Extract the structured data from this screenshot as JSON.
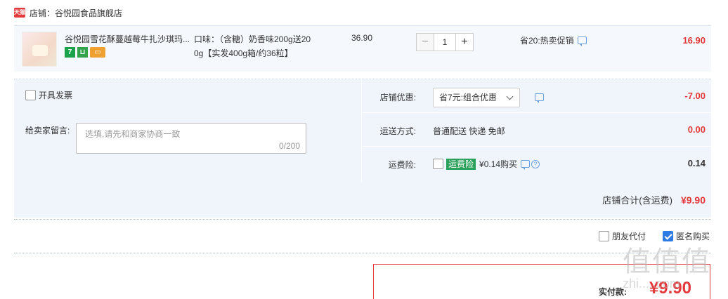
{
  "store": {
    "badge": "天猫",
    "title": "店铺：谷悦园食品旗舰店"
  },
  "item": {
    "title": "谷悦园雪花酥蔓越莓牛扎沙琪玛...",
    "sku_line1": "口味：（含糖）奶香味200g送20",
    "sku_line2": "0g【实发400g箱/约36粒】",
    "unit_price": "36.90",
    "quantity": "1",
    "minus": "−",
    "plus": "+",
    "promo": "省20:热卖促销",
    "total": "16.90",
    "icons": [
      "seven-day-return-icon",
      "guarantee-icon",
      "card-icon"
    ]
  },
  "invoice": {
    "label": "开具发票"
  },
  "message": {
    "label": "给卖家留言:",
    "placeholder": "选填,请先和商家协商一致",
    "counter": "0/200"
  },
  "discount": {
    "label": "店铺优惠:",
    "selected": "省7元:组合优惠",
    "amount": "-7.00"
  },
  "shipping": {
    "label": "运送方式:",
    "value": "普通配送 快递 免邮",
    "amount": "0.00"
  },
  "insurance": {
    "label": "运费险:",
    "tag": "运费险",
    "value": "¥0.14购买",
    "amount": "0.14"
  },
  "store_total": {
    "label": "店铺合计(含运费)",
    "amount": "¥9.90"
  },
  "options": {
    "friend_pay": "朋友代付",
    "anonymous": "匿名购买"
  },
  "payment": {
    "label": "实付款:",
    "amount": "¥9.90"
  },
  "watermark": {
    "glyphs": "值值值",
    "url": "zhi.....com"
  },
  "colors": {
    "accent_red": "#e4393c",
    "panel_bg": "#f0f4fb",
    "check_blue": "#2d7be5",
    "insurance_green": "#2aa05a"
  }
}
